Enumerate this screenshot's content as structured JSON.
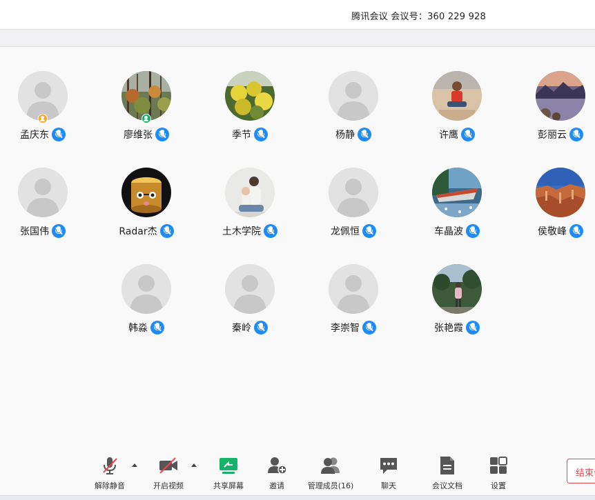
{
  "window": {
    "title": "腾讯会议 会议号：360 229 928"
  },
  "participants": [
    {
      "name": "孟庆东",
      "avatar": "default-avatar",
      "role": "host"
    },
    {
      "name": "廖维张",
      "avatar": "forest-photo",
      "role": "cohost"
    },
    {
      "name": "季节",
      "avatar": "yellow-flowers-photo",
      "role": ""
    },
    {
      "name": "杨静",
      "avatar": "default-avatar",
      "role": ""
    },
    {
      "name": "许鹰",
      "avatar": "beach-person-photo",
      "role": ""
    },
    {
      "name": "彭丽云",
      "avatar": "lake-sunset-photo",
      "role": ""
    },
    {
      "name": "张国伟",
      "avatar": "default-avatar",
      "role": ""
    },
    {
      "name": "Radar杰",
      "avatar": "cartoon-tree-stump",
      "role": ""
    },
    {
      "name": "土木学院",
      "avatar": "parent-child-photo",
      "role": ""
    },
    {
      "name": "龙佩恒",
      "avatar": "default-avatar",
      "role": ""
    },
    {
      "name": "车晶波",
      "avatar": "boat-photo",
      "role": ""
    },
    {
      "name": "侯敬峰",
      "avatar": "canyon-photo",
      "role": ""
    },
    {
      "name": "韩淼",
      "avatar": "default-avatar",
      "role": ""
    },
    {
      "name": "秦岭",
      "avatar": "default-avatar",
      "role": ""
    },
    {
      "name": "李崇智",
      "avatar": "default-avatar",
      "role": ""
    },
    {
      "name": "张艳霞",
      "avatar": "park-person-photo",
      "role": ""
    }
  ],
  "toolbar": {
    "unmute": {
      "label": "解除静音",
      "icon": "muted-mic-icon"
    },
    "video": {
      "label": "开启视频",
      "icon": "video-off-icon"
    },
    "share": {
      "label": "共享屏幕",
      "icon": "share-screen-icon"
    },
    "invite": {
      "label": "邀请",
      "icon": "invite-icon"
    },
    "members": {
      "label": "管理成员(16)",
      "icon": "members-icon"
    },
    "chat": {
      "label": "聊天",
      "icon": "chat-icon"
    },
    "docs": {
      "label": "会议文档",
      "icon": "document-icon"
    },
    "settings": {
      "label": "设置",
      "icon": "settings-grid-icon"
    },
    "end": {
      "label": "结束会议"
    }
  },
  "colors": {
    "mic_blue": "#1d8cf8",
    "share_green": "#17b26a",
    "end_red": "#e5484d",
    "host_badge": "#f5a623"
  }
}
